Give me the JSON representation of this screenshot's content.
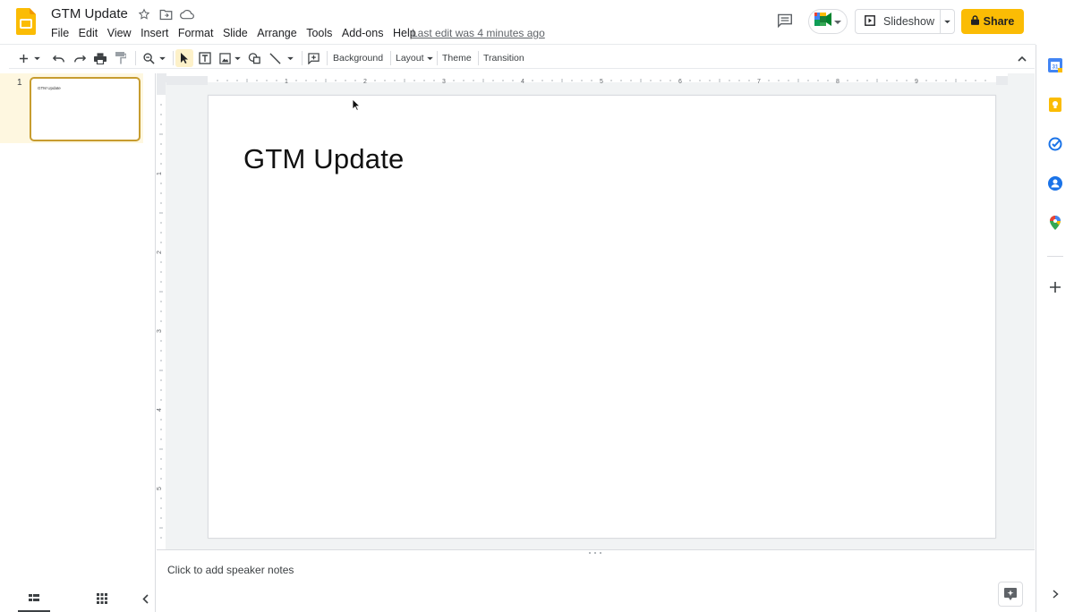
{
  "header": {
    "doc_title": "GTM Update",
    "menu": [
      "File",
      "Edit",
      "View",
      "Insert",
      "Format",
      "Slide",
      "Arrange",
      "Tools",
      "Add-ons",
      "Help"
    ],
    "last_edit": "Last edit was 4 minutes ago",
    "slideshow_label": "Slideshow",
    "share_label": "Share"
  },
  "toolbar": {
    "background_label": "Background",
    "layout_label": "Layout",
    "theme_label": "Theme",
    "transition_label": "Transition"
  },
  "ruler": {
    "horizontal": [
      "1",
      "2",
      "3",
      "4",
      "5",
      "6",
      "7",
      "8",
      "9"
    ],
    "vertical": [
      "1",
      "2",
      "3",
      "4",
      "5"
    ]
  },
  "filmstrip": {
    "slides": [
      {
        "number": "1",
        "title": "GTM Update"
      }
    ]
  },
  "slide": {
    "title": "GTM Update"
  },
  "notes": {
    "placeholder": "Click to add speaker notes"
  },
  "colors": {
    "brand_yellow": "#fbbc04",
    "selected_slide_bg": "#fef7e0",
    "selected_slide_border": "#c79c2f"
  },
  "icons": {
    "side_panel": [
      "calendar-icon",
      "keep-icon",
      "tasks-icon",
      "contacts-icon",
      "maps-icon",
      "add-icon"
    ]
  }
}
